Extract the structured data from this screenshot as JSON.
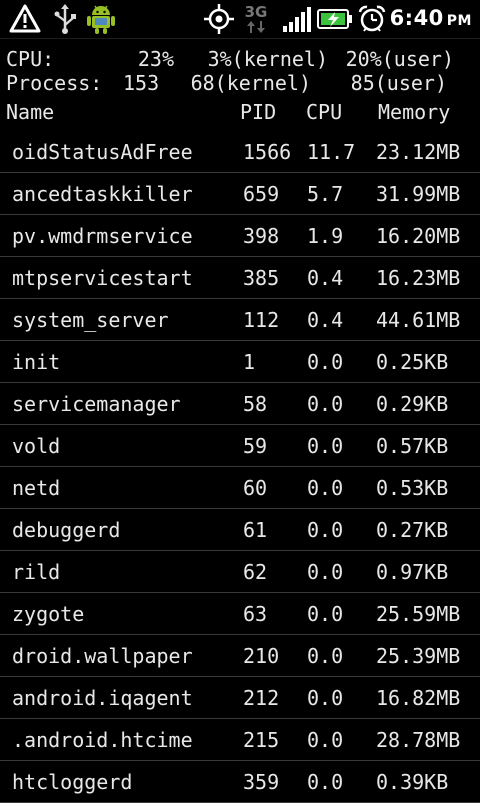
{
  "statusbar": {
    "network_type": "3G",
    "time": "6:40",
    "ampm": "PM"
  },
  "summary": {
    "cpu": {
      "label": "CPU:",
      "total": "23%",
      "kernel": "3%(kernel)",
      "user": "20%(user)"
    },
    "process": {
      "label": "Process:",
      "total": "153",
      "kernel": "68(kernel)",
      "user": "85(user)"
    }
  },
  "table": {
    "headers": {
      "name": "Name",
      "pid": "PID",
      "cpu": "CPU",
      "memory": "Memory"
    },
    "rows": [
      {
        "name": "oidStatusAdFree",
        "pid": "1566",
        "cpu": "11.7",
        "memory": "23.12MB"
      },
      {
        "name": "ancedtaskkiller",
        "pid": "659",
        "cpu": "5.7",
        "memory": "31.99MB"
      },
      {
        "name": "pv.wmdrmservice",
        "pid": "398",
        "cpu": "1.9",
        "memory": "16.20MB"
      },
      {
        "name": "mtpservicestart",
        "pid": "385",
        "cpu": "0.4",
        "memory": "16.23MB"
      },
      {
        "name": "system_server",
        "pid": "112",
        "cpu": "0.4",
        "memory": "44.61MB"
      },
      {
        "name": "init",
        "pid": "1",
        "cpu": "0.0",
        "memory": "0.25KB"
      },
      {
        "name": "servicemanager",
        "pid": "58",
        "cpu": "0.0",
        "memory": "0.29KB"
      },
      {
        "name": "vold",
        "pid": "59",
        "cpu": "0.0",
        "memory": "0.57KB"
      },
      {
        "name": "netd",
        "pid": "60",
        "cpu": "0.0",
        "memory": "0.53KB"
      },
      {
        "name": "debuggerd",
        "pid": "61",
        "cpu": "0.0",
        "memory": "0.27KB"
      },
      {
        "name": "rild",
        "pid": "62",
        "cpu": "0.0",
        "memory": "0.97KB"
      },
      {
        "name": "zygote",
        "pid": "63",
        "cpu": "0.0",
        "memory": "25.59MB"
      },
      {
        "name": "droid.wallpaper",
        "pid": "210",
        "cpu": "0.0",
        "memory": "25.39MB"
      },
      {
        "name": "android.iqagent",
        "pid": "212",
        "cpu": "0.0",
        "memory": "16.82MB"
      },
      {
        "name": ".android.htcime",
        "pid": "215",
        "cpu": "0.0",
        "memory": "28.78MB"
      },
      {
        "name": "htcloggerd",
        "pid": "359",
        "cpu": "0.0",
        "memory": "0.39KB"
      }
    ]
  },
  "icons": [
    "warning-icon",
    "usb-icon",
    "android-debug-icon",
    "gps-icon",
    "data-arrows-icon",
    "signal-bars-icon",
    "battery-charging-icon",
    "alarm-clock-icon"
  ]
}
